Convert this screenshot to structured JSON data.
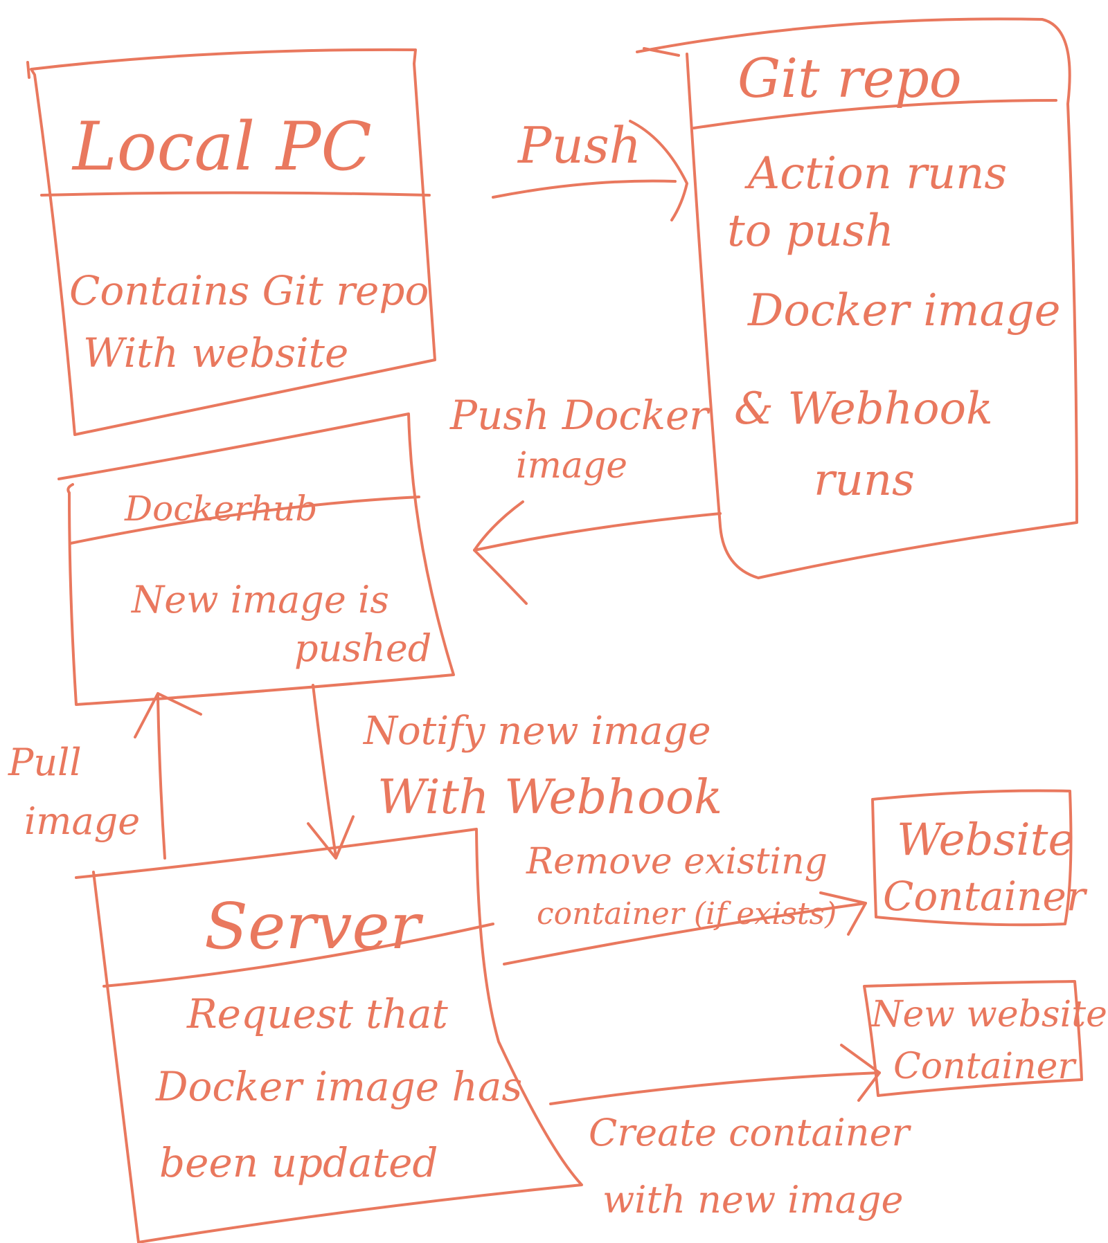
{
  "ink_color": "#e9785e",
  "nodes": {
    "local_pc": {
      "title": "Local PC",
      "body": [
        "Contains Git repo",
        "With website"
      ]
    },
    "git_repo": {
      "title": "Git repo",
      "body": [
        "Action runs",
        "to push",
        "Docker image",
        "& Webhook",
        "runs"
      ]
    },
    "dockerhub": {
      "title": "Dockerhub",
      "body": [
        "New image is",
        "pushed"
      ]
    },
    "server": {
      "title": "Server",
      "body": [
        "Request that",
        "Docker image has",
        "been updated"
      ]
    },
    "website_container": {
      "lines": [
        "Website",
        "Container"
      ]
    },
    "new_website_container": {
      "lines": [
        "New website",
        "Container"
      ]
    }
  },
  "edges": {
    "push": {
      "lines": [
        "Push"
      ]
    },
    "push_docker_image": {
      "lines": [
        "Push Docker",
        "image"
      ]
    },
    "notify": {
      "lines": [
        "Notify new image",
        "With Webhook"
      ]
    },
    "pull_image": {
      "lines": [
        "Pull",
        "image"
      ]
    },
    "remove_existing": {
      "lines": [
        "Remove existing",
        "container (if exists)"
      ]
    },
    "create_container": {
      "lines": [
        "Create container",
        "with new image"
      ]
    }
  }
}
